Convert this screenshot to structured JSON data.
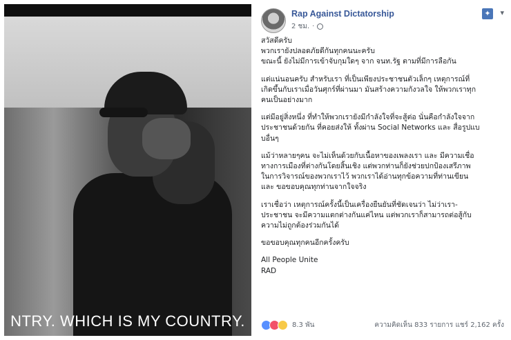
{
  "photo": {
    "caption": "NTRY. WHICH IS MY COUNTRY."
  },
  "post": {
    "page_name": "Rap Against Dictatorship",
    "time": "2 ชม.",
    "paragraphs": [
      [
        "สวัสดีครับ",
        "พวกเรายังปลอดภัยดีกันทุกคนนะครับ",
        "ขณะนี้ ยังไม่มีการเข้าจับกุมใดๆ จาก จนท.รัฐ ตามที่มีการลือกัน"
      ],
      [
        "แต่แน่นอนครับ สำหรับเรา ที่เป็นเพียงประชาชนตัวเล็กๆ เหตุการณ์ที่",
        "เกิดขึ้นกับเราเมื่อวันศุกร์ที่ผ่านมา มันสร้างความกังวลใจ ให้พวกเราทุก",
        "คนเป็นอย่างมาก"
      ],
      [
        "แต่มีอยู่สิ่งหนึ่ง ที่ทำให้พวกเรายังมีกำลังใจที่จะสู้ต่อ นั่นคือกำลังใจจาก",
        "ประชาชนด้วยกัน ที่คอยส่งให้ ทั้งผ่าน Social Networks และ สื่อรูปแบ",
        "บอื่นๆ"
      ],
      [
        "แม้ว่าหลายๆคน จะไม่เห็นด้วยกับเนื้อหาของเพลงเรา และ มีความเชื่อ",
        "ทางการเมืองที่ต่างกันโดยสิ้นเชิง แต่พวกท่านก็ยังช่วยปกป้องเสรีภาพ",
        "ในการวิจารณ์ของพวกเราไว้ พวกเราได้อ่านทุกข้อความที่ท่านเขียน",
        "และ ขอขอบคุณทุกท่านจากใจจริง"
      ],
      [
        "เราเชื่อว่า เหตุการณ์ครั้งนี้เป็นเครื่องยืนยันที่ชัดเจนว่า ไม่ว่าเรา-",
        "ประชาชน จะมีความแตกต่างกันแค่ไหน แต่พวกเราก็สามารถต่อสู้กับ",
        "ความไม่ถูกต้องร่วมกันได้"
      ],
      [
        "ขอขอบคุณทุกคนอีกครั้งครับ"
      ],
      [
        "All People Unite",
        "RAD"
      ]
    ],
    "reactions_count": "8.3 พัน",
    "comments": "ความคิดเห็น 833 รายการ",
    "shares": "แชร์ 2,162 ครั้ง"
  },
  "icons": {
    "globe": "globe-icon",
    "pin": "pin-icon",
    "chevron": "chevron-down-icon",
    "reactions": [
      "like-icon",
      "love-icon",
      "haha-icon"
    ]
  },
  "colors": {
    "page_name": "#385898",
    "text": "#1c1e21",
    "meta": "#606770",
    "pin": "#4a76b8"
  }
}
